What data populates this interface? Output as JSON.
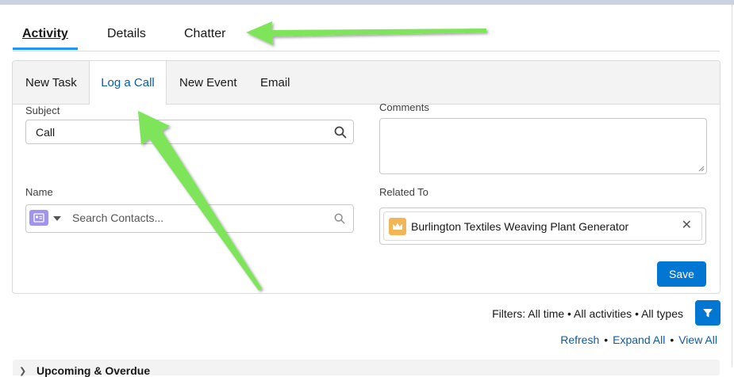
{
  "tabs": [
    "Activity",
    "Details",
    "Chatter"
  ],
  "composer": {
    "tabs": [
      "New Task",
      "Log a Call",
      "New Event",
      "Email"
    ],
    "active_tab": "Log a Call",
    "subject_label": "Subject",
    "subject_value": "Call",
    "comments_label": "Comments",
    "name_label": "Name",
    "name_placeholder": "Search Contacts...",
    "related_label": "Related To",
    "related_value": "Burlington Textiles Weaving Plant Generator",
    "save_label": "Save"
  },
  "filters_text": "Filters: All time • All activities • All types",
  "links": [
    "Refresh",
    "Expand All",
    "View All"
  ],
  "section_title": "Upcoming & Overdue",
  "colors": {
    "brand": "#0176d3",
    "link": "#0b5cab",
    "tab_underline": "#1b96ff",
    "annotation_arrow": "#7ee55a"
  },
  "icons": [
    "search-icon",
    "contact-icon",
    "chevron-down-icon",
    "crown-icon",
    "close-icon",
    "filter-icon",
    "chevron-right-icon"
  ]
}
